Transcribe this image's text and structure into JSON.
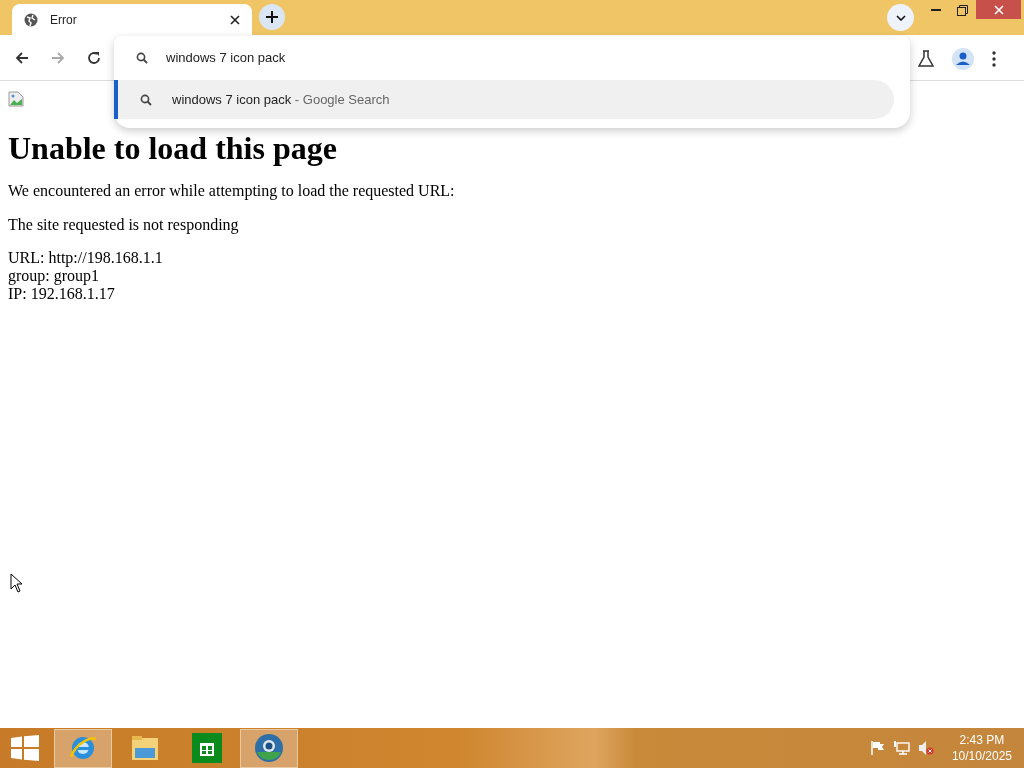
{
  "tab": {
    "title": "Error",
    "selected": true
  },
  "omnibox": {
    "value": "windows 7 icon pack",
    "suggestions": [
      {
        "text": "windows 7 icon pack",
        "source": "- Google Search",
        "selected": true
      }
    ]
  },
  "page": {
    "heading": "Unable to load this page",
    "paragraphs": [
      "We encountered an error while attempting to load the requested URL:",
      "The site requested is not responding"
    ],
    "details": [
      "URL: http://198.168.1.1",
      "group: group1",
      "IP: 192.168.1.17"
    ]
  },
  "taskbar": {
    "apps": [
      {
        "kind": "browser-e",
        "active": true
      },
      {
        "kind": "folder",
        "active": false
      },
      {
        "kind": "store",
        "active": false
      },
      {
        "kind": "browser-globe",
        "active": true
      }
    ],
    "time": "2:43 PM",
    "date": "10/10/2025"
  }
}
